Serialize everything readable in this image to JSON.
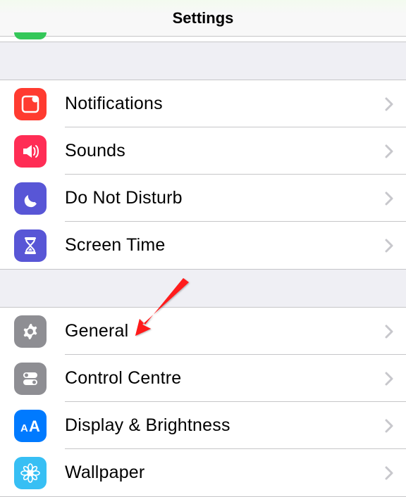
{
  "header": {
    "title": "Settings"
  },
  "groups": [
    {
      "rows": [
        {
          "id": "notifications",
          "label": "Notifications",
          "icon": "notifications-icon",
          "iconBg": "#ff3b30"
        },
        {
          "id": "sounds",
          "label": "Sounds",
          "icon": "sounds-icon",
          "iconBg": "#ff2d55"
        },
        {
          "id": "do-not-disturb",
          "label": "Do Not Disturb",
          "icon": "moon-icon",
          "iconBg": "#5856d6"
        },
        {
          "id": "screen-time",
          "label": "Screen Time",
          "icon": "hourglass-icon",
          "iconBg": "#5856d6"
        }
      ]
    },
    {
      "rows": [
        {
          "id": "general",
          "label": "General",
          "icon": "gear-icon",
          "iconBg": "#8e8e93"
        },
        {
          "id": "control-centre",
          "label": "Control Centre",
          "icon": "toggles-icon",
          "iconBg": "#8e8e93"
        },
        {
          "id": "display-brightness",
          "label": "Display & Brightness",
          "icon": "text-size-icon",
          "iconBg": "#007aff"
        },
        {
          "id": "wallpaper",
          "label": "Wallpaper",
          "icon": "flower-icon",
          "iconBg": "#37bff4"
        }
      ]
    }
  ],
  "annotation": {
    "target": "general"
  }
}
